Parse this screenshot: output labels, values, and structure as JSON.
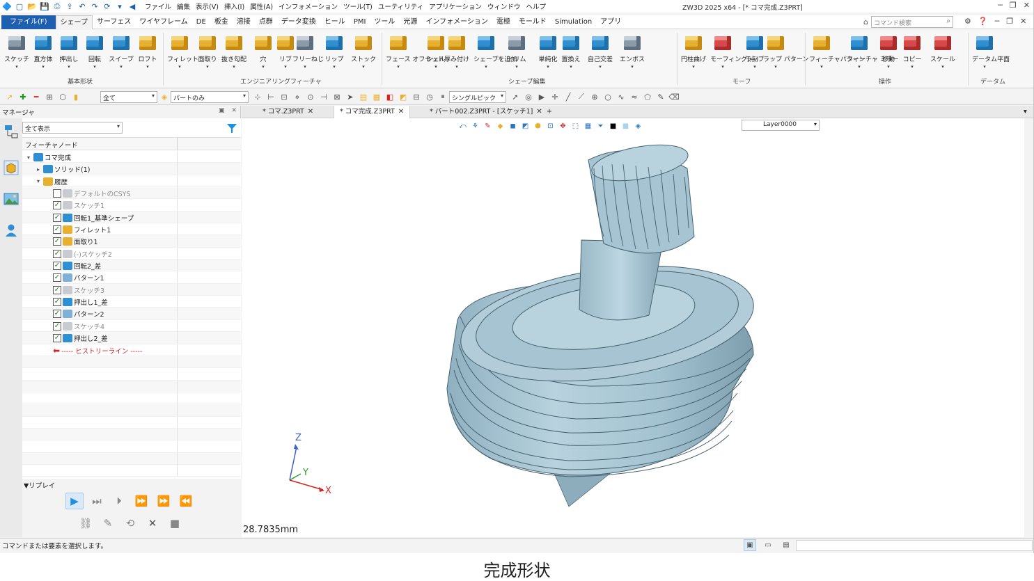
{
  "titlebar": {
    "menu": [
      "ファイル",
      "編集",
      "表示(V)",
      "挿入(I)",
      "属性(A)",
      "インフォメーション",
      "ツール(T)",
      "ユーティリティ",
      "アプリケーション",
      "ウィンドウ",
      "ヘルプ"
    ],
    "window_title": "ZW3D 2025 x64 - [* コマ完成.Z3PRT]"
  },
  "ribbon_tabs": [
    "ファイル(F)",
    "シェープ",
    "サーフェス",
    "ワイヤフレーム",
    "DE",
    "板金",
    "溶接",
    "点群",
    "データ変換",
    "ヒール",
    "PMI",
    "ツール",
    "光源",
    "インフォメーション",
    "電極",
    "モールド",
    "Simulation",
    "アプリ"
  ],
  "active_tab": "シェープ",
  "command_search_placeholder": "コマンド検索",
  "ribbon": {
    "groups": [
      {
        "label": "基本形状",
        "buttons": [
          "スケッチ",
          "直方体",
          "押出し",
          "回転",
          "スイープ",
          "ロフト"
        ]
      },
      {
        "label": "エンジニアリングフィーチャ",
        "buttons": [
          "フィレット",
          "面取り",
          "抜き勾配",
          "穴",
          "リブ",
          "フリーねじ",
          "リップ",
          "ストック"
        ]
      },
      {
        "label": "シェープ編集",
        "buttons": [
          "フェース オフセット",
          "シェル",
          "厚み付け",
          "シェープを追加",
          "トリム",
          "単純化",
          "置換え",
          "自己交差",
          "エンボス"
        ]
      },
      {
        "label": "モーフ",
        "buttons": [
          "円柱曲げ",
          "モーフィング(点)",
          "ラップ",
          "ラップ パターン"
        ]
      },
      {
        "label": "操作",
        "buttons": [
          "フィーチャパターン",
          "フィーチャ ミラー",
          "移動",
          "コピー",
          "スケール"
        ]
      },
      {
        "label": "データム",
        "buttons": [
          "データム平面"
        ]
      }
    ]
  },
  "toolbar": {
    "filter_select": "全て",
    "part_select": "パートのみ",
    "pick_select": "シングルピック"
  },
  "manager": {
    "title": "マネージャ",
    "show_select": "全て表示",
    "column_header": "フィーチャノード",
    "tree": [
      {
        "label": "コマ完成",
        "indent": 0,
        "toggle": "v",
        "check": "none",
        "icon": "blue",
        "style": "normal"
      },
      {
        "label": "ソリッド(1)",
        "indent": 1,
        "toggle": ">",
        "check": "none",
        "icon": "blue",
        "style": "normal"
      },
      {
        "label": "履歴",
        "indent": 1,
        "toggle": "v",
        "check": "none",
        "icon": "yel",
        "style": "normal"
      },
      {
        "label": "デフォルトのCSYS",
        "indent": 2,
        "toggle": "",
        "check": "off",
        "icon": "gry",
        "style": "dim"
      },
      {
        "label": "スケッチ1",
        "indent": 2,
        "toggle": "",
        "check": "on",
        "icon": "gry",
        "style": "dim"
      },
      {
        "label": "回転1_基準シェープ",
        "indent": 2,
        "toggle": "",
        "check": "on",
        "icon": "blue",
        "style": "normal"
      },
      {
        "label": "フィレット1",
        "indent": 2,
        "toggle": "",
        "check": "on",
        "icon": "yel",
        "style": "normal"
      },
      {
        "label": "面取り1",
        "indent": 2,
        "toggle": "",
        "check": "on",
        "icon": "yel",
        "style": "normal"
      },
      {
        "label": "(-)スケッチ2",
        "indent": 2,
        "toggle": "",
        "check": "on",
        "icon": "gry",
        "style": "dim"
      },
      {
        "label": "回転2_差",
        "indent": 2,
        "toggle": "",
        "check": "on",
        "icon": "blue",
        "style": "normal"
      },
      {
        "label": "パターン1",
        "indent": 2,
        "toggle": "",
        "check": "on",
        "icon": "grn",
        "style": "normal"
      },
      {
        "label": "スケッチ3",
        "indent": 2,
        "toggle": "",
        "check": "on",
        "icon": "gry",
        "style": "dim"
      },
      {
        "label": "押出し1_差",
        "indent": 2,
        "toggle": "",
        "check": "on",
        "icon": "blue",
        "style": "normal"
      },
      {
        "label": "パターン2",
        "indent": 2,
        "toggle": "",
        "check": "on",
        "icon": "grn",
        "style": "normal"
      },
      {
        "label": "スケッチ4",
        "indent": 2,
        "toggle": "",
        "check": "on",
        "icon": "gry",
        "style": "dim"
      },
      {
        "label": "押出し2_差",
        "indent": 2,
        "toggle": "",
        "check": "on",
        "icon": "blue",
        "style": "normal"
      },
      {
        "label": "----- ヒストリーライン -----",
        "indent": 2,
        "toggle": "",
        "check": "none",
        "icon": "arrow",
        "style": "red"
      }
    ],
    "replay_title": "▼リプレイ"
  },
  "doc_tabs": [
    "* コマ.Z3PRT",
    "* コマ完成.Z3PRT",
    "* パート002.Z3PRT - [スケッチ1]"
  ],
  "active_doc": "* コマ完成.Z3PRT",
  "viewport": {
    "layer": "Layer0000",
    "scale": "28.7835mm",
    "axes": {
      "z": "Z",
      "y": "Y",
      "x": "X"
    }
  },
  "status": {
    "message": "コマンドまたは要素を選択します。"
  },
  "caption": "完成形状",
  "colors": {
    "accent": "#1e5fb0",
    "model": "#a9c6d3",
    "history_line": "#d82020"
  }
}
